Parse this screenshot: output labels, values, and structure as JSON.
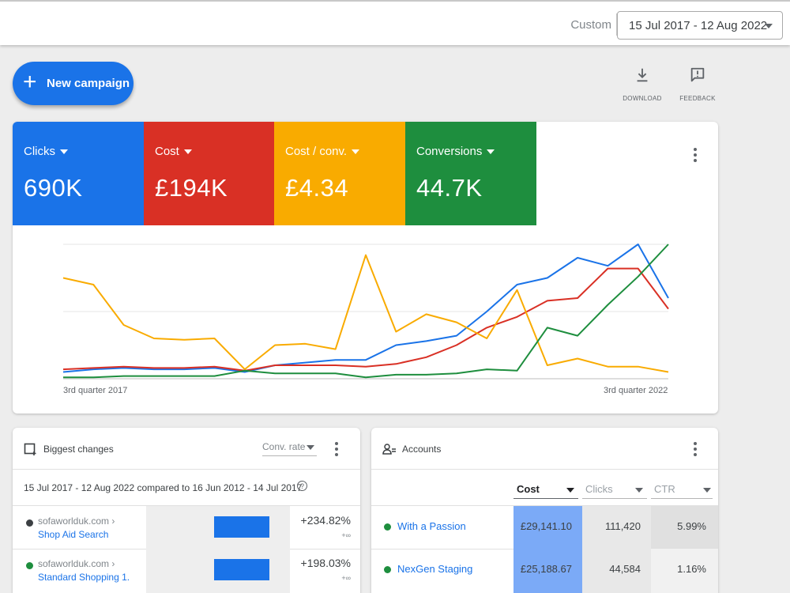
{
  "topbar": {
    "custom_label": "Custom",
    "date_range": "15 Jul 2017 - 12 Aug 2022"
  },
  "actions": {
    "new_campaign": "New campaign",
    "download": "DOWNLOAD",
    "feedback": "FEEDBACK"
  },
  "metrics": [
    {
      "label": "Clicks",
      "value": "690K",
      "color": "#1a73e8"
    },
    {
      "label": "Cost",
      "value": "£194K",
      "color": "#d93025"
    },
    {
      "label": "Cost / conv.",
      "value": "£4.34",
      "color": "#f9ab00"
    },
    {
      "label": "Conversions",
      "value": "44.7K",
      "color": "#1e8e3e"
    }
  ],
  "chart_data": {
    "type": "line",
    "x_start_label": "3rd quarter 2017",
    "x_end_label": "3rd quarter 2022",
    "points": 21,
    "ylim": [
      0,
      100
    ],
    "grid": true,
    "series": [
      {
        "name": "Clicks",
        "color": "#1a73e8",
        "values": [
          5,
          7,
          8,
          7,
          7,
          8,
          5,
          10,
          12,
          14,
          14,
          25,
          28,
          32,
          50,
          70,
          75,
          90,
          84,
          100,
          60
        ]
      },
      {
        "name": "Cost",
        "color": "#d93025",
        "values": [
          7,
          8,
          9,
          8,
          8,
          9,
          6,
          10,
          10,
          10,
          9,
          11,
          16,
          25,
          38,
          46,
          58,
          60,
          82,
          82,
          52
        ]
      },
      {
        "name": "Cost / conv.",
        "color": "#f9ab00",
        "values": [
          75,
          70,
          40,
          30,
          29,
          30,
          7,
          25,
          26,
          22,
          92,
          35,
          48,
          42,
          30,
          66,
          10,
          15,
          9,
          9,
          5
        ]
      },
      {
        "name": "Conversions",
        "color": "#1e8e3e",
        "values": [
          1,
          1,
          2,
          2,
          2,
          2,
          6,
          4,
          4,
          4,
          1,
          3,
          3,
          4,
          7,
          6,
          38,
          32,
          55,
          76,
          100
        ]
      }
    ]
  },
  "biggest_changes": {
    "title": "Biggest changes",
    "metric_select": "Conv. rate",
    "comparison": "15 Jul 2017 - 12 Aug 2022 compared to 16 Jun 2012 - 14 Jul 2017",
    "rows": [
      {
        "site": "sofaworlduk.com ›",
        "campaign": "Shop Aid Search",
        "change": "+234.82%",
        "delta": "+∞",
        "fraction": 1.0
      },
      {
        "site": "sofaworlduk.com ›",
        "campaign": "Standard Shopping 1.",
        "change": "+198.03%",
        "delta": "+∞",
        "fraction": 1.0
      }
    ]
  },
  "accounts": {
    "title": "Accounts",
    "columns": [
      "Cost",
      "Clicks",
      "CTR"
    ],
    "rows": [
      {
        "name": "With a Passion",
        "cost": "£29,141.10",
        "clicks": "111,420",
        "ctr": "5.99%"
      },
      {
        "name": "NexGen Staging",
        "cost": "£25,188.67",
        "clicks": "44,584",
        "ctr": "1.16%"
      }
    ]
  }
}
